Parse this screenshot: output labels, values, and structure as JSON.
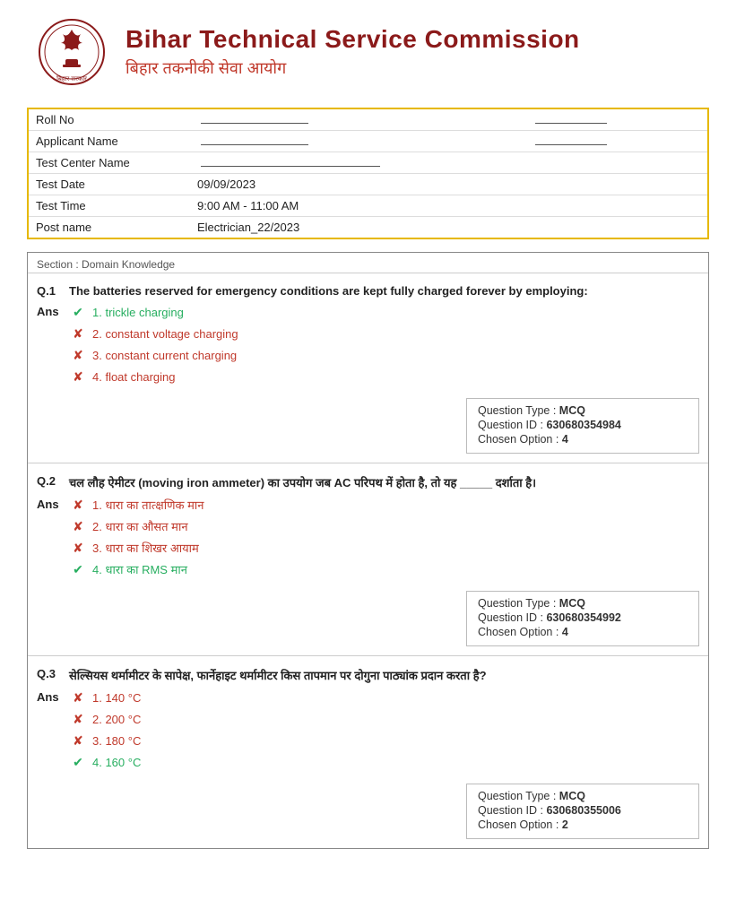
{
  "header": {
    "title_en": "Bihar Technical Service Commission",
    "title_hi": "बिहार तकनीकी सेवा आयोग"
  },
  "info": {
    "roll_no_label": "Roll No",
    "applicant_name_label": "Applicant Name",
    "test_center_label": "Test Center Name",
    "test_date_label": "Test Date",
    "test_date_value": "09/09/2023",
    "test_time_label": "Test Time",
    "test_time_value": "9:00 AM - 11:00 AM",
    "post_name_label": "Post name",
    "post_name_value": "Electrician_22/2023"
  },
  "section_label": "Section : Domain Knowledge",
  "questions": [
    {
      "num": "Q.1",
      "text": "The batteries reserved for emergency conditions are kept fully charged forever by employing:",
      "ans_label": "Ans",
      "options": [
        {
          "num": "1",
          "text": "trickle charging",
          "status": "correct"
        },
        {
          "num": "2",
          "text": "constant voltage charging",
          "status": "wrong"
        },
        {
          "num": "3",
          "text": "constant current charging",
          "status": "wrong"
        },
        {
          "num": "4",
          "text": "float charging",
          "status": "wrong"
        }
      ],
      "q_type": "MCQ",
      "q_id": "630680354984",
      "chosen_option": "4"
    },
    {
      "num": "Q.2",
      "text": "चल लौह ऐमीटर (moving iron ammeter) का उपयोग जब AC परिपथ में होता है, तो यह _____ दर्शाता है।",
      "ans_label": "Ans",
      "options": [
        {
          "num": "1",
          "text": "धारा का तात्क्षणिक मान",
          "status": "wrong"
        },
        {
          "num": "2",
          "text": "धारा का औसत मान",
          "status": "wrong"
        },
        {
          "num": "3",
          "text": "धारा का शिखर आयाम",
          "status": "wrong"
        },
        {
          "num": "4",
          "text": "धारा का RMS मान",
          "status": "correct"
        }
      ],
      "q_type": "MCQ",
      "q_id": "630680354992",
      "chosen_option": "4"
    },
    {
      "num": "Q.3",
      "text": "सेल्सियस थर्मामीटर के सापेक्ष, फार्नेहाइट थर्मामीटर किस तापमान पर दोगुना पाठ्यांक प्रदान करता है?",
      "ans_label": "Ans",
      "options": [
        {
          "num": "1",
          "text": "140 °C",
          "status": "wrong"
        },
        {
          "num": "2",
          "text": "200 °C",
          "status": "wrong"
        },
        {
          "num": "3",
          "text": "180 °C",
          "status": "wrong"
        },
        {
          "num": "4",
          "text": "160 °C",
          "status": "correct"
        }
      ],
      "q_type": "MCQ",
      "q_id": "630680355006",
      "chosen_option": "2"
    }
  ],
  "q_type_label": "Question Type : ",
  "q_id_label": "Question ID : ",
  "chosen_label": "Chosen Option : "
}
